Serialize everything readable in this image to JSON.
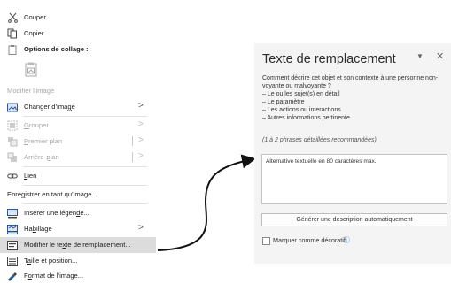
{
  "menu": {
    "cut": "Couper",
    "copy": "Copier",
    "paste_options": "Options de collage :",
    "edit_image": "Modifier l’image",
    "change_image": "Changer d’image",
    "group": "Grouper",
    "bring_front": "Premier plan",
    "send_back": "Arrière-plan",
    "link": "Lien",
    "save_as_image": "Enregistrer en tant qu’image...",
    "insert_caption": "Insérer une légende...",
    "wrap_text": "Habillage",
    "edit_alt_text": "Modifier le texte de remplacement...",
    "size_position": "Taille et position...",
    "format_image": "Format de l’image...",
    "submenu_arrow": ">"
  },
  "pane": {
    "title": "Texte de remplacement",
    "description": "Comment décrire cet objet et son contexte à une personne non-voyante ou malvoyante ?",
    "bullets": [
      "– Le ou les sujet(s) en détail",
      "– Le paramètre",
      "– Les actions ou interactions",
      "– Autres informations pertinente"
    ],
    "hint": "(1 à 2 phrases détaillées recommandées)",
    "alt_text_value": "Alternative textuelle en 80 caractères max.",
    "generate_button": "Générer une description automatiquement",
    "decorative_label": "Marquer comme décoratif",
    "decorative_checked": false
  }
}
